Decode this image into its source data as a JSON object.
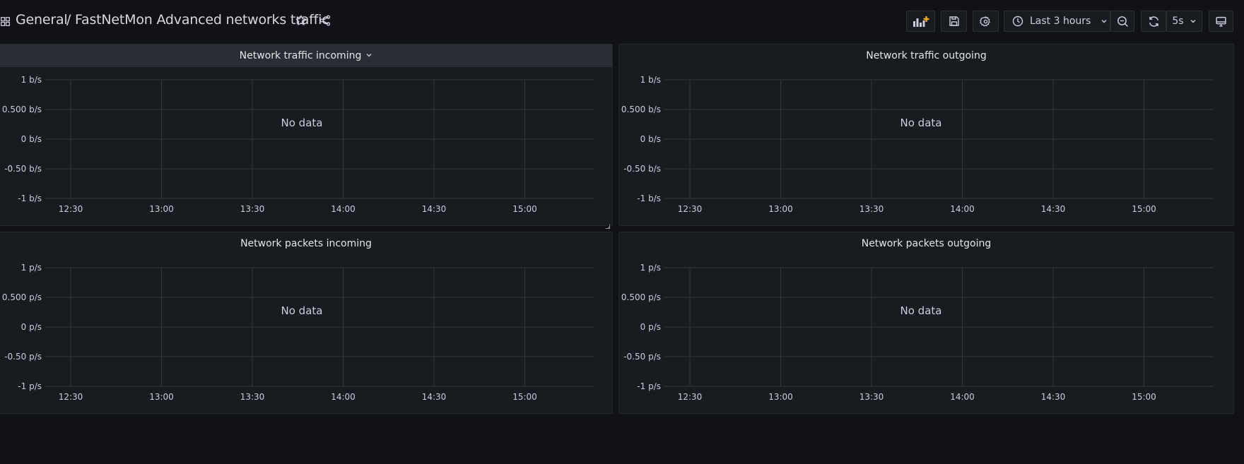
{
  "header": {
    "folder": "General",
    "title": "/ FastNetMon Advanced networks traffic",
    "time_range": "Last 3 hours",
    "refresh_interval": "5s",
    "icons": [
      "dashboard-grid-icon",
      "star-icon",
      "share-icon",
      "add-panel-icon",
      "save-icon",
      "settings-icon",
      "clock-icon",
      "chevron-down-icon",
      "zoom-out-icon",
      "refresh-icon",
      "tv-mode-icon"
    ],
    "accent_color": "#f5a623"
  },
  "x_ticks": [
    "12:30",
    "13:00",
    "13:30",
    "14:00",
    "14:30",
    "15:00"
  ],
  "no_data_text": "No data",
  "panels": [
    {
      "title": "Network traffic incoming",
      "y_ticks": [
        "1 b/s",
        "0.500 b/s",
        "0 b/s",
        "-0.50 b/s",
        "-1 b/s"
      ]
    },
    {
      "title": "Network traffic outgoing",
      "y_ticks": [
        "1 b/s",
        "0.500 b/s",
        "0 b/s",
        "-0.50 b/s",
        "-1 b/s"
      ]
    },
    {
      "title": "Network packets incoming",
      "y_ticks": [
        "1 p/s",
        "0.500 p/s",
        "0 p/s",
        "-0.50 p/s",
        "-1 p/s"
      ]
    },
    {
      "title": "Network packets outgoing",
      "y_ticks": [
        "1 p/s",
        "0.500 p/s",
        "0 p/s",
        "-0.50 p/s",
        "-1 p/s"
      ]
    }
  ],
  "chart_data": [
    {
      "type": "line",
      "title": "Network traffic incoming",
      "ylim": [
        -1,
        1
      ],
      "x": [
        "12:30",
        "13:00",
        "13:30",
        "14:00",
        "14:30",
        "15:00"
      ],
      "series": []
    },
    {
      "type": "line",
      "title": "Network traffic outgoing",
      "ylim": [
        -1,
        1
      ],
      "x": [
        "12:30",
        "13:00",
        "13:30",
        "14:00",
        "14:30",
        "15:00"
      ],
      "series": []
    },
    {
      "type": "line",
      "title": "Network packets incoming",
      "ylim": [
        -1,
        1
      ],
      "x": [
        "12:30",
        "13:00",
        "13:30",
        "14:00",
        "14:30",
        "15:00"
      ],
      "series": []
    },
    {
      "type": "line",
      "title": "Network packets outgoing",
      "ylim": [
        -1,
        1
      ],
      "x": [
        "12:30",
        "13:00",
        "13:30",
        "14:00",
        "14:30",
        "15:00"
      ],
      "series": []
    }
  ]
}
